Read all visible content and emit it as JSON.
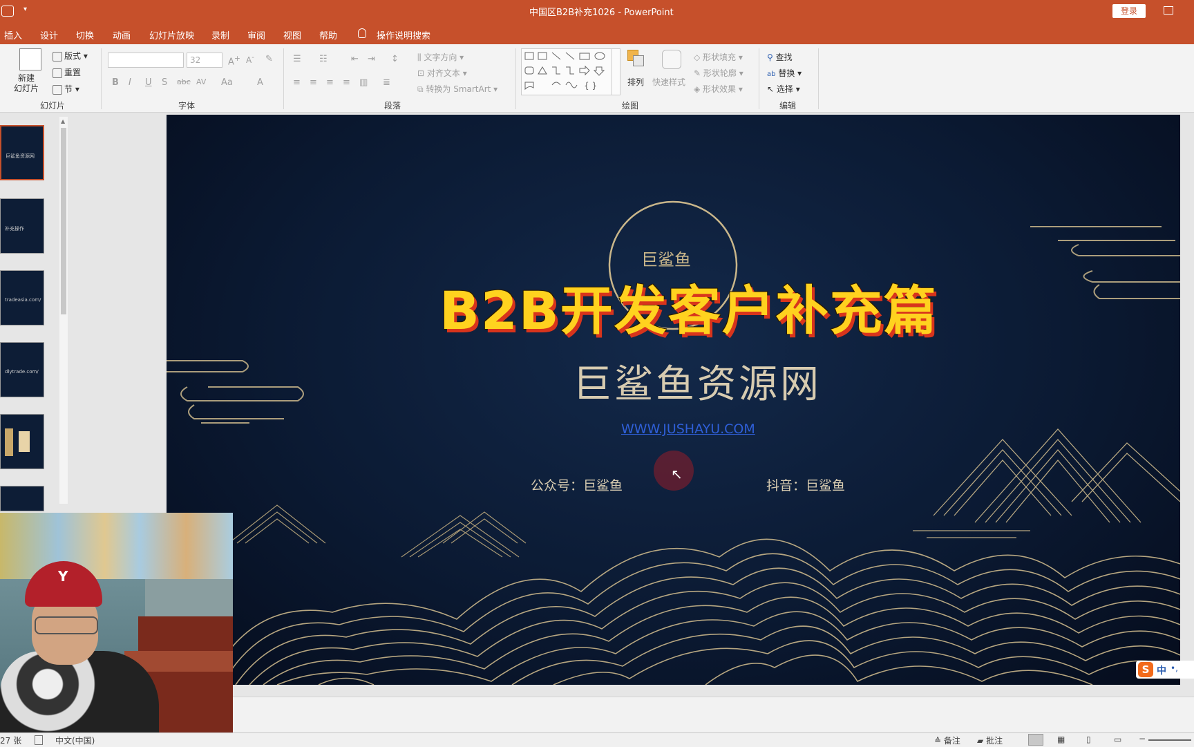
{
  "titlebar": {
    "title": "中国区B2B补充1026  -  PowerPoint",
    "login": "登录"
  },
  "menu": {
    "items": [
      "插入",
      "设计",
      "切换",
      "动画",
      "幻灯片放映",
      "录制",
      "审阅",
      "视图",
      "帮助"
    ],
    "search": "操作说明搜索"
  },
  "ribbon": {
    "slides": {
      "new_slide": "新建\n幻灯片",
      "layout": "版式",
      "reset": "重置",
      "section": "节",
      "label": "幻灯片"
    },
    "font": {
      "label": "字体",
      "size_placeholder": "32"
    },
    "paragraph": {
      "text_direction": "文字方向",
      "align_text": "对齐文本",
      "convert_smartart": "转换为 SmartArt",
      "label": "段落"
    },
    "drawing": {
      "arrange": "排列",
      "quick_styles": "快速样式",
      "shape_fill": "形状填充",
      "shape_outline": "形状轮廓",
      "shape_effects": "形状效果",
      "label": "绘图"
    },
    "editing": {
      "find": "查找",
      "replace": "替换",
      "select": "选择",
      "label": "编辑"
    }
  },
  "thumbnails": [
    {
      "caption": "巨鲨鱼资源网"
    },
    {
      "caption": "补充操作"
    },
    {
      "caption": "tradeasia.com/"
    },
    {
      "caption": "dlytrade.com/"
    },
    {
      "caption": ""
    },
    {
      "caption": ""
    }
  ],
  "slide": {
    "logo_text": "巨鲨鱼",
    "overlay_title": "B2B开发客户补充篇",
    "site_name": "巨鲨鱼资源网",
    "url": "WWW.JUSHAYU.COM",
    "wechat": "公众号：巨鲨鱼",
    "douyin": "抖音：巨鲨鱼"
  },
  "ime": {
    "label": "中"
  },
  "statusbar": {
    "slide_count": "27 张",
    "language": "中文(中国)",
    "notes": "备注",
    "comments": "批注"
  },
  "colors": {
    "accent": "#c6502b",
    "slide_bg": "#0b1a33",
    "gold": "#c9b68a",
    "overlay_yellow": "#ffd21f",
    "overlay_shadow": "#d8341c"
  }
}
